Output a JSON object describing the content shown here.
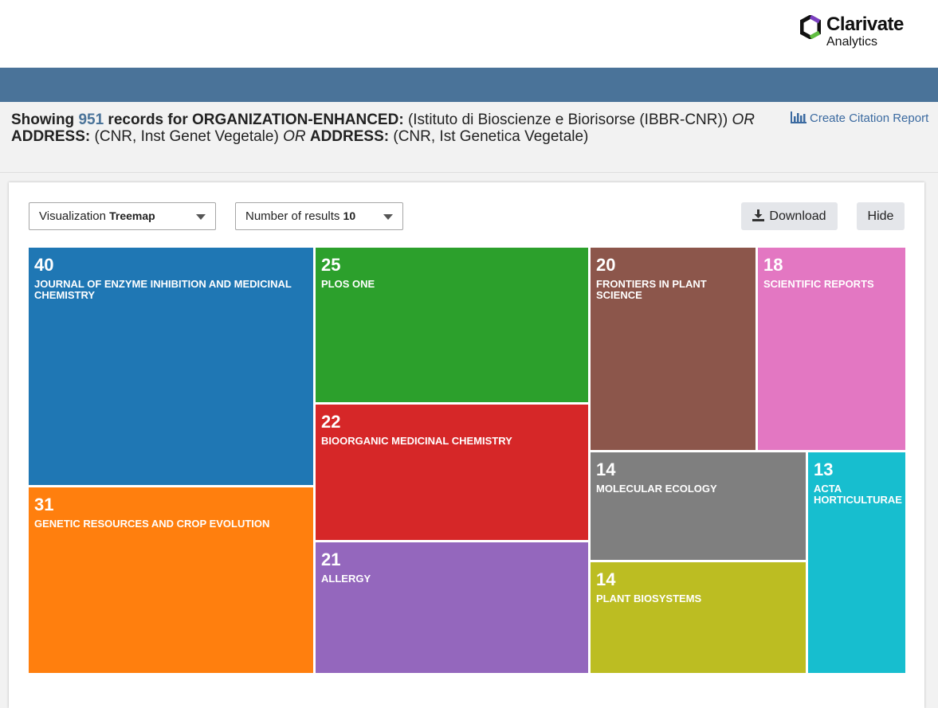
{
  "brand": {
    "name": "Clarivate",
    "sub": "Analytics",
    "logo_icon": "clarivate-logo-icon"
  },
  "summary": {
    "showing": "Showing",
    "count": "951",
    "records_for": "records for",
    "f1_label": "ORGANIZATION-ENHANCED:",
    "f1_value": "(Istituto di Bioscienze e Biorisorse (IBBR-CNR))",
    "op1": "OR",
    "f2_label": "ADDRESS:",
    "f2_value": "(CNR, Inst Genet Vegetale)",
    "op2": "OR",
    "f3_label": "ADDRESS:",
    "f3_value": "(CNR, Ist Genetica Vegetale)"
  },
  "citation_report": {
    "label": "Create Citation Report",
    "icon": "bar-chart-icon"
  },
  "controls": {
    "visualization_label": "Visualization",
    "visualization_value": "Treemap",
    "results_label": "Number of results",
    "results_value": "10",
    "download_label": "Download",
    "download_icon": "download-icon",
    "hide_label": "Hide"
  },
  "chart_data": {
    "type": "treemap",
    "items": [
      {
        "value": 40,
        "label": "JOURNAL OF ENZYME INHIBITION AND MEDICINAL CHEMISTRY",
        "color": "#1f77b4"
      },
      {
        "value": 31,
        "label": "GENETIC RESOURCES AND CROP EVOLUTION",
        "color": "#ff7f0e"
      },
      {
        "value": 25,
        "label": "PLOS ONE",
        "color": "#2ca02c"
      },
      {
        "value": 22,
        "label": "BIOORGANIC MEDICINAL CHEMISTRY",
        "color": "#d62728"
      },
      {
        "value": 21,
        "label": "ALLERGY",
        "color": "#9467bd"
      },
      {
        "value": 20,
        "label": "FRONTIERS IN PLANT SCIENCE",
        "color": "#8c564b"
      },
      {
        "value": 18,
        "label": "SCIENTIFIC REPORTS",
        "color": "#e377c2"
      },
      {
        "value": 14,
        "label": "MOLECULAR ECOLOGY",
        "color": "#7f7f7f"
      },
      {
        "value": 14,
        "label": "PLANT BIOSYSTEMS",
        "color": "#bcbd22"
      },
      {
        "value": 13,
        "label": "ACTA HORTICULTURAE",
        "color": "#17becf"
      }
    ]
  }
}
